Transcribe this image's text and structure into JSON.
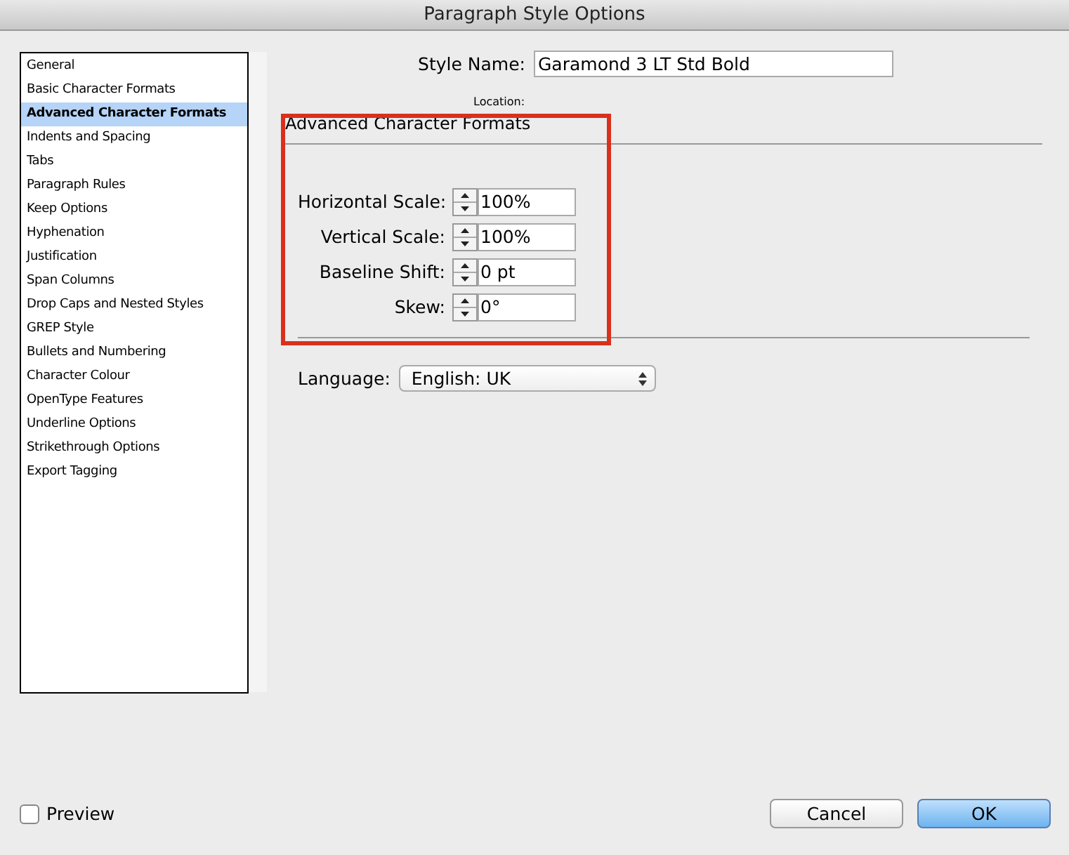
{
  "window": {
    "title": "Paragraph Style Options"
  },
  "sidebar": {
    "items": [
      {
        "label": "General",
        "selected": false
      },
      {
        "label": "Basic Character Formats",
        "selected": false
      },
      {
        "label": "Advanced Character Formats",
        "selected": true
      },
      {
        "label": "Indents and Spacing",
        "selected": false
      },
      {
        "label": "Tabs",
        "selected": false
      },
      {
        "label": "Paragraph Rules",
        "selected": false
      },
      {
        "label": "Keep Options",
        "selected": false
      },
      {
        "label": "Hyphenation",
        "selected": false
      },
      {
        "label": "Justification",
        "selected": false
      },
      {
        "label": "Span Columns",
        "selected": false
      },
      {
        "label": "Drop Caps and Nested Styles",
        "selected": false
      },
      {
        "label": "GREP Style",
        "selected": false
      },
      {
        "label": "Bullets and Numbering",
        "selected": false
      },
      {
        "label": "Character Colour",
        "selected": false
      },
      {
        "label": "OpenType Features",
        "selected": false
      },
      {
        "label": "Underline Options",
        "selected": false
      },
      {
        "label": "Strikethrough Options",
        "selected": false
      },
      {
        "label": "Export Tagging",
        "selected": false
      }
    ]
  },
  "style_name": {
    "label": "Style Name:",
    "value": "Garamond 3 LT Std Bold"
  },
  "location": {
    "label": "Location:"
  },
  "section": {
    "title": "Advanced Character Formats",
    "fields": [
      {
        "label": "Horizontal Scale:",
        "value": "100%"
      },
      {
        "label": "Vertical Scale:",
        "value": "100%"
      },
      {
        "label": "Baseline Shift:",
        "value": "0 pt"
      },
      {
        "label": "Skew:",
        "value": "0°"
      }
    ]
  },
  "language": {
    "label": "Language:",
    "value": "English: UK"
  },
  "annotation": {
    "kind": "highlight"
  },
  "preview": {
    "label": "Preview",
    "checked": false
  },
  "buttons": [
    {
      "label": "Cancel",
      "kind": "secondary"
    },
    {
      "label": "OK",
      "kind": "default"
    }
  ]
}
